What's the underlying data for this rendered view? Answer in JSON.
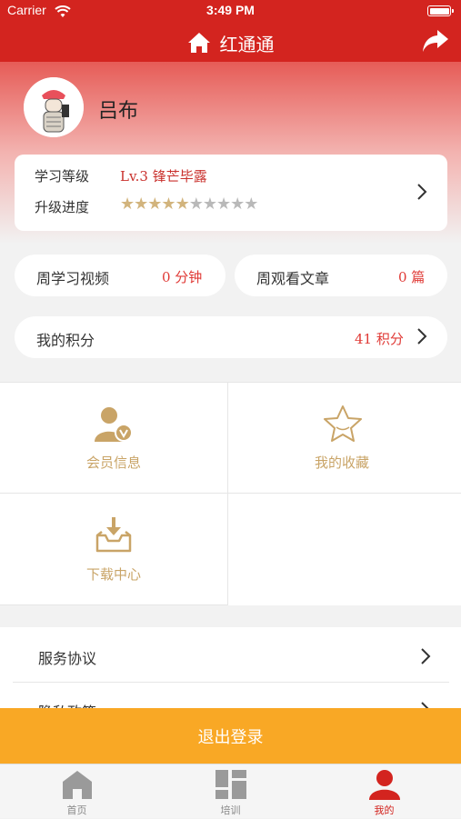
{
  "status_bar": {
    "carrier": "Carrier",
    "time": "3:49 PM"
  },
  "nav": {
    "title": "红通通",
    "left_icon": "home-icon",
    "right_icon": "share-icon"
  },
  "profile": {
    "name": "吕布"
  },
  "level": {
    "label": "学习等级",
    "value": "Lv.3 锋芒毕露",
    "progress_label": "升级进度",
    "stars_filled": 5,
    "stars_total": 10
  },
  "stats": {
    "video_label": "周学习视频",
    "video_value": "0 分钟",
    "article_label": "周观看文章",
    "article_value": "0 篇",
    "points_label": "我的积分",
    "points_value": "41 积分"
  },
  "grid": [
    {
      "label": "会员信息",
      "icon": "member-icon"
    },
    {
      "label": "我的收藏",
      "icon": "star-icon"
    },
    {
      "label": "下载中心",
      "icon": "download-icon"
    }
  ],
  "list": [
    {
      "label": "服务协议"
    },
    {
      "label": "隐私政策"
    }
  ],
  "logout_label": "退出登录",
  "tabs": [
    {
      "label": "首页",
      "icon": "home-icon",
      "active": false
    },
    {
      "label": "培训",
      "icon": "grid-icon",
      "active": false
    },
    {
      "label": "我的",
      "icon": "user-icon",
      "active": true
    }
  ],
  "colors": {
    "brand_red": "#d3241f",
    "gold": "#c9a467",
    "logout_orange": "#f9a825",
    "value_red": "#e03a36"
  }
}
